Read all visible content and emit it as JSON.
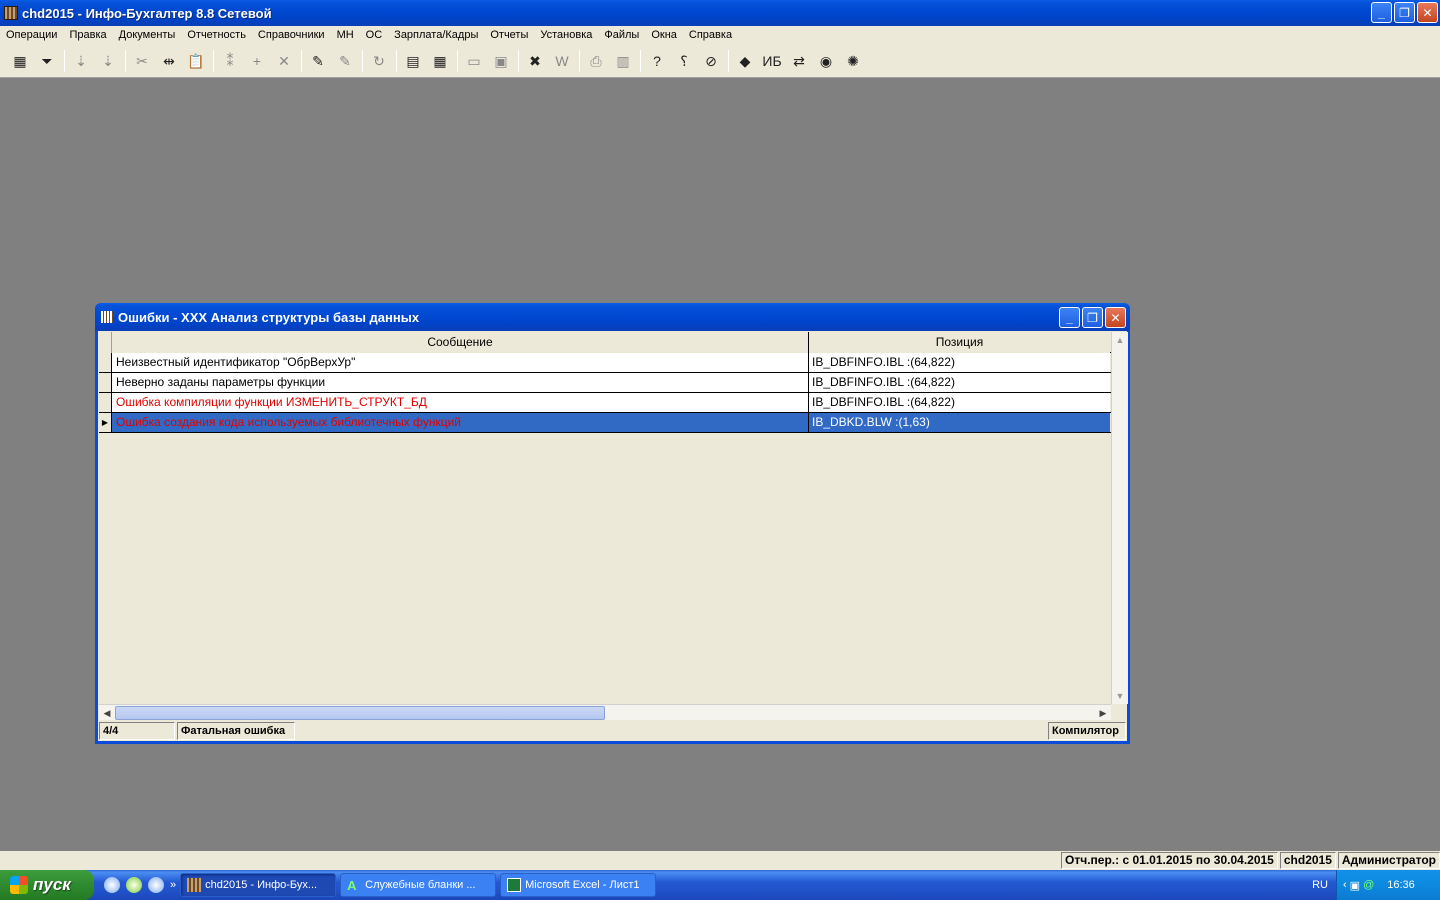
{
  "app": {
    "title": "chd2015 - Инфо-Бухгалтер 8.8 Сетевой",
    "window_buttons": {
      "minimize": "_",
      "restore": "❐",
      "close": "✕"
    }
  },
  "menu": [
    "Операции",
    "Правка",
    "Документы",
    "Отчетность",
    "Справочники",
    "МН",
    "ОС",
    "Зарплата/Кадры",
    "Отчеты",
    "Установка",
    "Файлы",
    "Окна",
    "Справка"
  ],
  "toolbar": {
    "buttons": [
      {
        "name": "grid-view-icon",
        "glyph": "▦",
        "active": true
      },
      {
        "name": "filter-icon",
        "glyph": "⏷",
        "active": true
      },
      {
        "sep": true
      },
      {
        "name": "sort-asc-icon",
        "glyph": "⇣",
        "active": false
      },
      {
        "name": "sort-desc-icon",
        "glyph": "⇣",
        "active": false
      },
      {
        "sep": true
      },
      {
        "name": "cut-icon",
        "glyph": "✂",
        "active": false
      },
      {
        "name": "split-icon",
        "glyph": "⇹",
        "active": true
      },
      {
        "name": "paste-icon",
        "glyph": "📋",
        "active": false
      },
      {
        "sep": true
      },
      {
        "name": "numbering-icon",
        "glyph": "⁑",
        "active": false
      },
      {
        "name": "add-icon",
        "glyph": "+",
        "active": false
      },
      {
        "name": "delete-icon",
        "glyph": "✕",
        "active": false
      },
      {
        "sep": true
      },
      {
        "name": "marker-icon",
        "glyph": "✎",
        "active": true
      },
      {
        "name": "clear-marker-icon",
        "glyph": "✎",
        "active": false
      },
      {
        "sep": true
      },
      {
        "name": "refresh-icon",
        "glyph": "↻",
        "active": false
      },
      {
        "sep": true
      },
      {
        "name": "pdf-icon",
        "glyph": "▤",
        "active": true
      },
      {
        "name": "calculator-icon",
        "glyph": "▦",
        "active": true
      },
      {
        "sep": true
      },
      {
        "name": "open-folder-icon",
        "glyph": "▭",
        "active": false
      },
      {
        "name": "save-icon",
        "glyph": "▣",
        "active": false
      },
      {
        "sep": true
      },
      {
        "name": "excel-icon",
        "glyph": "✖",
        "active": true
      },
      {
        "name": "word-icon",
        "glyph": "W",
        "active": false
      },
      {
        "sep": true
      },
      {
        "name": "print-icon",
        "glyph": "⎙",
        "active": false
      },
      {
        "name": "preview-icon",
        "glyph": "▥",
        "active": false
      },
      {
        "sep": true
      },
      {
        "name": "help-icon",
        "glyph": "?",
        "active": true
      },
      {
        "name": "context-help-icon",
        "glyph": "⸮",
        "active": true
      },
      {
        "name": "compass-icon",
        "glyph": "⊘",
        "active": true
      },
      {
        "sep": true
      },
      {
        "name": "game-icon",
        "glyph": "◆",
        "active": true
      },
      {
        "name": "ib10-icon",
        "glyph": "ИБ",
        "active": true
      },
      {
        "name": "teamviewer-icon",
        "glyph": "⇄",
        "active": true
      },
      {
        "name": "web-icon",
        "glyph": "◉",
        "active": true
      },
      {
        "name": "network-icon",
        "glyph": "✺",
        "active": true
      }
    ]
  },
  "errors_window": {
    "title": "Ошибки - XXX Анализ структуры базы данных",
    "columns": [
      "Сообщение",
      "Позиция"
    ],
    "rows": [
      {
        "message": "Неизвестный идентификатор \"ОбрВерхУр\"",
        "position": "IB_DBFINFO.IBL :(64,822)",
        "red": false,
        "selected": false
      },
      {
        "message": "Неверно заданы параметры функции",
        "position": "IB_DBFINFO.IBL :(64,822)",
        "red": false,
        "selected": false
      },
      {
        "message": "Ошибка компиляции функции ИЗМЕНИТЬ_СТРУКТ_БД",
        "position": "IB_DBFINFO.IBL :(64,822)",
        "red": true,
        "selected": false
      },
      {
        "message": "Ошибка создания кода используемых библиотечных функций",
        "position": "IB_DBKD.BLW :(1,63)",
        "red": true,
        "selected": true
      }
    ],
    "status": {
      "counter": "4/4",
      "severity": "Фатальная ошибка",
      "source": "Компилятор"
    }
  },
  "app_status": {
    "period": "Отч.пер.: с 01.01.2015 по 30.04.2015",
    "db": "chd2015",
    "user": "Администратор"
  },
  "taskbar": {
    "start_label": "пуск",
    "tasks": [
      {
        "label": "chd2015 - Инфо-Бух...",
        "active": true
      },
      {
        "label": "Служебные бланки ...",
        "active": false
      },
      {
        "label": "Microsoft Excel - Лист1",
        "active": false
      }
    ],
    "lang": "RU",
    "clock": "16:36"
  }
}
